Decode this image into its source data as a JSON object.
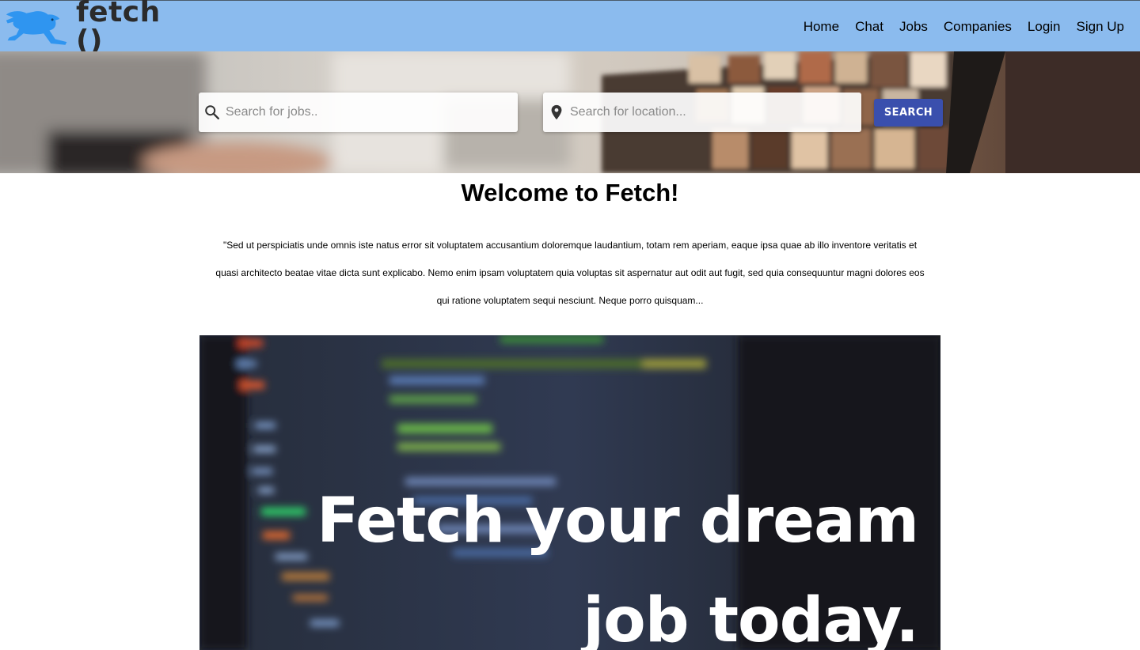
{
  "brand": {
    "name": "fetch ()"
  },
  "nav": {
    "items": [
      {
        "label": "Home"
      },
      {
        "label": "Chat"
      },
      {
        "label": "Jobs"
      },
      {
        "label": "Companies"
      },
      {
        "label": "Login"
      },
      {
        "label": "Sign Up"
      }
    ]
  },
  "search": {
    "jobs_placeholder": "Search for jobs..",
    "jobs_value": "",
    "location_placeholder": "Search for location...",
    "location_value": "",
    "button_label": "SEARCH"
  },
  "main": {
    "title": "Welcome to Fetch!",
    "paragraph": "\"Sed ut perspiciatis unde omnis iste natus error sit voluptatem accusantium doloremque laudantium, totam rem aperiam, eaque ipsa quae ab illo inventore veritatis et quasi architecto beatae vitae dicta sunt explicabo. Nemo enim ipsam voluptatem quia voluptas sit aspernatur aut odit aut fugit, sed quia consequuntur magni dolores eos qui ratione voluptatem sequi nesciunt. Neque porro quisquam..."
  },
  "banner": {
    "line1": "Fetch your dream",
    "line2": "job today."
  },
  "icons": {
    "logo": "flying-dog-logo-icon",
    "search": "search-icon",
    "location": "location-pin-icon"
  },
  "colors": {
    "navbar": "#8bbbee",
    "logo_blue": "#2f95f0",
    "search_button": "#3a4fad"
  }
}
